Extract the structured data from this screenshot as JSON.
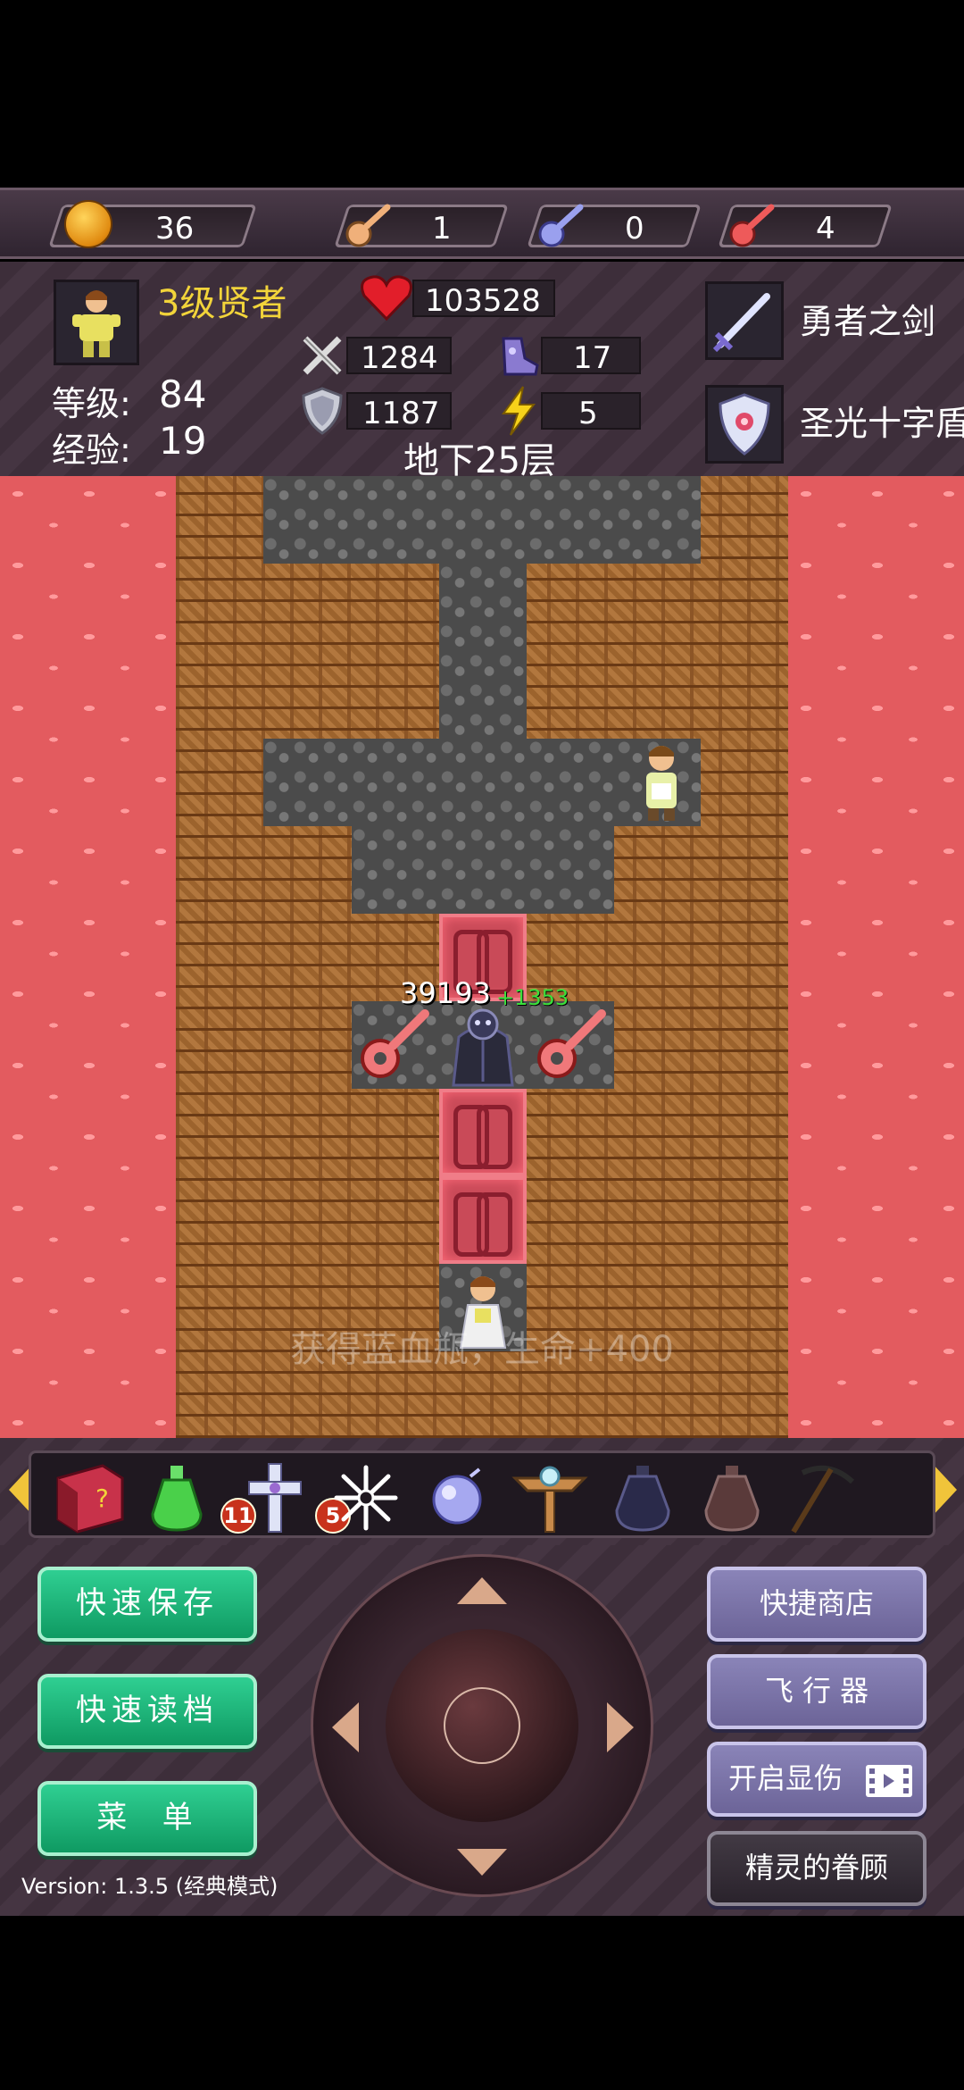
{
  "resources": {
    "gold": "36",
    "yellow_keys": "1",
    "blue_keys": "0",
    "red_keys": "4"
  },
  "hero": {
    "title": "3级贤者",
    "level_label": "等级:",
    "level": "84",
    "exp_label": "经验:",
    "exp": "19",
    "hp": "103528",
    "attack": "1284",
    "defense": "1187",
    "magic_defense": "17",
    "agility": "5",
    "floor": "地下25层",
    "weapon": "勇者之剑",
    "shield": "圣光十字盾"
  },
  "map": {
    "damage_value": "39193",
    "damage_bonus": "+1353",
    "toast": "获得蓝血瓶，生命+400"
  },
  "items": {
    "potion_count": "11",
    "cross_count": "5",
    "list": [
      "monster-book-icon",
      "green-potion-icon",
      "holy-cross-icon",
      "snowflake-icon",
      "orb-icon",
      "winged-staff-icon",
      "dark-vase-icon",
      "brown-vase-icon",
      "pickaxe-icon"
    ]
  },
  "controls": {
    "quick_save": "快速保存",
    "quick_load": "快速读档",
    "menu": "菜  单",
    "quick_shop": "快捷商店",
    "flyer": "飞 行 器",
    "show_damage": "开启显伤",
    "fairy_favor": "精灵的眷顾",
    "version": "Version: 1.3.5 (经典模式)"
  },
  "colors": {
    "lava": "#e35b5f",
    "green_button": "#1fb97b",
    "purple_button": "#7a74a8",
    "title_gold": "#f2d43a",
    "bonus_green": "#3be03b"
  }
}
